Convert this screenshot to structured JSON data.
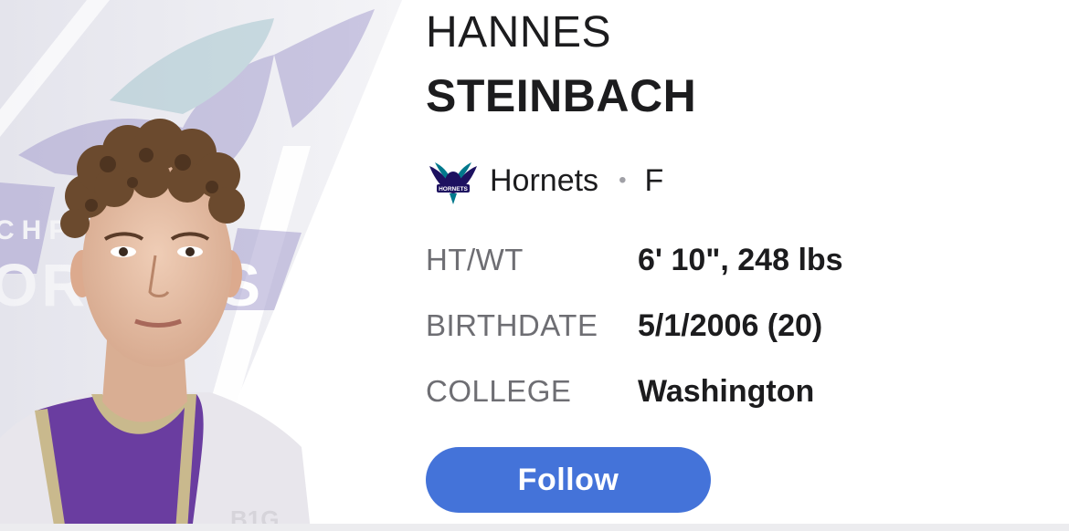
{
  "player": {
    "first_name": "HANNES",
    "last_name": "STEINBACH",
    "team": "Hornets",
    "separator": "•",
    "position": "F"
  },
  "stats": [
    {
      "label": "HT/WT",
      "value": "6' 10\", 248 lbs"
    },
    {
      "label": "BIRTHDATE",
      "value": "5/1/2006 (20)"
    },
    {
      "label": "COLLEGE",
      "value": "Washington"
    }
  ],
  "actions": {
    "follow_label": "Follow"
  },
  "background_logo": {
    "text_top": "CHP",
    "text_big": "ORNETS"
  },
  "jersey_mark": "B1G",
  "team_logo_text": "HORNETS",
  "colors": {
    "accent": "#4473d9",
    "team_purple": "#1d1160",
    "team_teal": "#00788c",
    "jersey_purple": "#6a3da0",
    "jersey_gold": "#c9b98d"
  },
  "icons": {
    "team_logo": "hornets-logo-icon",
    "player_photo": "player-headshot"
  }
}
